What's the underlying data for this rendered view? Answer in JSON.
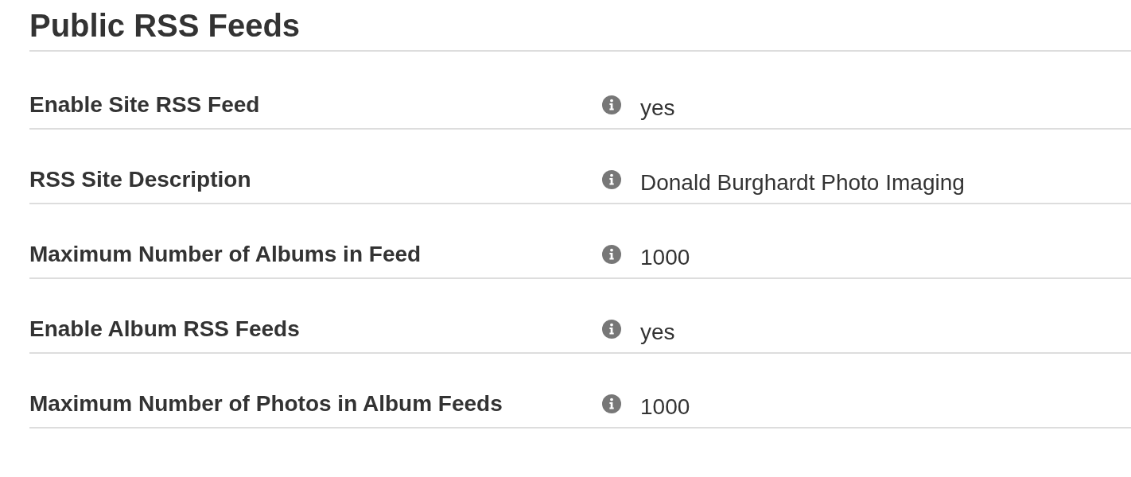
{
  "section": {
    "title": "Public RSS Feeds"
  },
  "settings": [
    {
      "label": "Enable Site RSS Feed",
      "value": "yes"
    },
    {
      "label": "RSS Site Description",
      "value": "Donald Burghardt Photo Imaging"
    },
    {
      "label": "Maximum Number of Albums in Feed",
      "value": "1000"
    },
    {
      "label": "Enable Album RSS Feeds",
      "value": "yes"
    },
    {
      "label": "Maximum Number of Photos in Album Feeds",
      "value": "1000"
    }
  ]
}
